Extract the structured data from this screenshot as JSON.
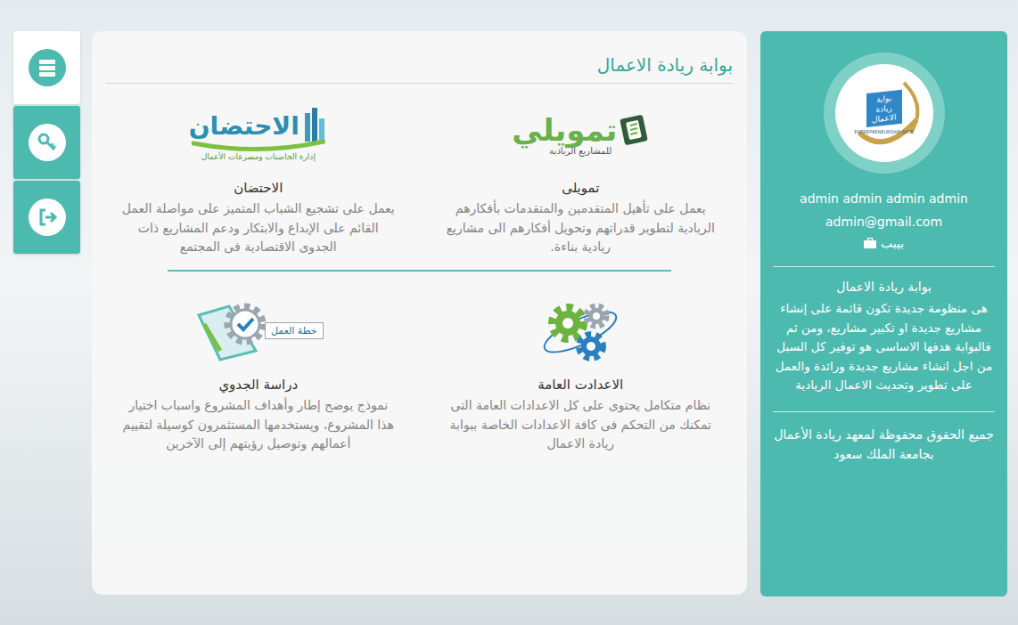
{
  "nav": [
    {
      "selected": true
    },
    {
      "selected": false
    },
    {
      "selected": false
    }
  ],
  "main": {
    "title": "بوابة ريادة الاعمال",
    "cards": [
      {
        "kind": "tamweely",
        "title": "تمويلى",
        "description": "يعمل على تأهيل المتقدمين والمتقدمات بأفكارهم الريادية لتطوير قدراتهم وتحويل أفكارهم الى مشاريع ريادية بناءة.",
        "logo": {
          "text": "تمويلي",
          "subtext": "للمشاريع الريادية"
        }
      },
      {
        "kind": "incubation",
        "title": "الاحتضان",
        "description": "يعمل على تشجيع الشباب المتميز على مواصلة العمل القائم على الإبداع والابتكار ودعم المشاريع ذات الجدوى الاقتصادية فى المجتمع",
        "logo": {
          "text": "الاحتضان",
          "subtext": "إدارة الحاضنات ومسرعات الأعمال"
        }
      },
      {
        "kind": "settings",
        "title": "الاعدادت العامة",
        "description": "نظام متكامل يحتوى على كل الاعدادات العامة التى تمكنك من التحكم فى كافة الاعدادات الخاصة ببوابة ريادة الاعمال",
        "logo": {
          "text": "",
          "subtext": ""
        }
      },
      {
        "kind": "plan",
        "title": "دراسة الجدوي",
        "description": "نموذج يوضح إطار وأهداف المشروع واسباب اختيار هذا المشروع، ويستخدمها المستثمرون كوسيلة لتقييم أعمالهم وتوصيل رؤيتهم إلى الآخرين",
        "logo": {
          "text": "خطة العمل",
          "subtext": ""
        }
      }
    ]
  },
  "sidebar": {
    "logo": {
      "lines": [
        "بوابة",
        "ريادة",
        "الاعمال"
      ],
      "caption": "ENTREPRENEURSHIP GATE"
    },
    "name": "admin admin admin admin",
    "email": "admin@gmail.com",
    "role": "بيبب",
    "about_title": "بوابة ريادة الاعمال",
    "about_text": "هى منظومة جديدة تكون قائمة على إنشاء مشاريع جديدة او تكبير مشاريع، ومن ثم فالبوابة هدفها الاساسى هو توفير كل السبل من اجل انشاء مشاريع جديدة ورائدة والعمل على تطوير وتحديث الاعمال الريادية",
    "copyright": "جميع الحقوق محفوظة لمعهد ريادة الأعمال بجامعة الملك سعود"
  }
}
